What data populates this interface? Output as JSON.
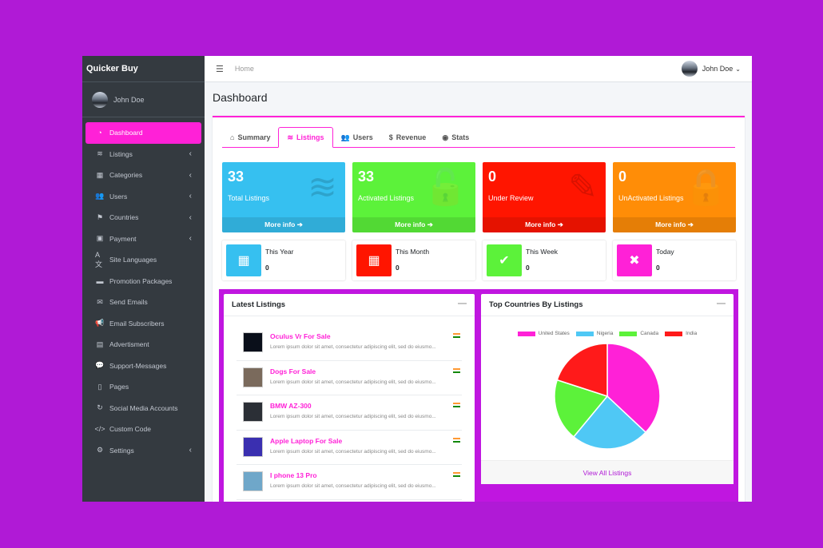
{
  "app": {
    "brand": "Quicker Buy",
    "user_name": "John Doe"
  },
  "sidebar": {
    "items": [
      {
        "label": "Dashboard",
        "icon": "tachometer-icon",
        "glyph": "◔",
        "has_chevron": false
      },
      {
        "label": "Listings",
        "icon": "layers-icon",
        "glyph": "≋",
        "has_chevron": true
      },
      {
        "label": "Categories",
        "icon": "grid-icon",
        "glyph": "▦",
        "has_chevron": true
      },
      {
        "label": "Users",
        "icon": "users-icon",
        "glyph": "👥",
        "has_chevron": true
      },
      {
        "label": "Countries",
        "icon": "flag-checkered-icon",
        "glyph": "⚑",
        "has_chevron": true
      },
      {
        "label": "Payment",
        "icon": "money-icon",
        "glyph": "▣",
        "has_chevron": true
      },
      {
        "label": "Site Languages",
        "icon": "language-icon",
        "glyph": "A文",
        "has_chevron": false
      },
      {
        "label": "Promotion Packages",
        "icon": "gift-icon",
        "glyph": "▬",
        "has_chevron": false
      },
      {
        "label": "Send Emails",
        "icon": "envelope-icon",
        "glyph": "✉",
        "has_chevron": false
      },
      {
        "label": "Email Subscribers",
        "icon": "bullhorn-icon",
        "glyph": "📢",
        "has_chevron": false
      },
      {
        "label": "Advertisment",
        "icon": "ad-icon",
        "glyph": "▤",
        "has_chevron": false
      },
      {
        "label": "Support-Messages",
        "icon": "comments-icon",
        "glyph": "💬",
        "has_chevron": false
      },
      {
        "label": "Pages",
        "icon": "file-icon",
        "glyph": "▯",
        "has_chevron": false
      },
      {
        "label": "Social Media Accounts",
        "icon": "sync-icon",
        "glyph": "↻",
        "has_chevron": false
      },
      {
        "label": "Custom Code",
        "icon": "code-icon",
        "glyph": "</>",
        "has_chevron": false
      },
      {
        "label": "Settings",
        "icon": "cogs-icon",
        "glyph": "⚙",
        "has_chevron": true
      }
    ],
    "active_index": 0
  },
  "topbar": {
    "breadcrumb": "Home",
    "user_name": "John Doe",
    "caret": "⌄"
  },
  "page": {
    "title": "Dashboard"
  },
  "tabs": [
    {
      "label": "Summary",
      "icon": "home-icon",
      "glyph": "⌂"
    },
    {
      "label": "Listings",
      "icon": "layers-icon",
      "glyph": "≋"
    },
    {
      "label": "Users",
      "icon": "users-icon",
      "glyph": "👥"
    },
    {
      "label": "Revenue",
      "icon": "dollar-icon",
      "glyph": "$"
    },
    {
      "label": "Stats",
      "icon": "eye-icon",
      "glyph": "◉"
    }
  ],
  "active_tab": 1,
  "stat_boxes": [
    {
      "value": "33",
      "label": "Total Listings",
      "more": "More info ➔",
      "color": "#36c0f0",
      "icon": "layers-icon",
      "glyph": "≋"
    },
    {
      "value": "33",
      "label": "Activated Listings",
      "more": "More info ➔",
      "color": "#5cf23a",
      "icon": "unlock-icon",
      "glyph": "🔓"
    },
    {
      "value": "0",
      "label": "Under Review",
      "more": "More info ➔",
      "color": "#ff1500",
      "icon": "pencil-icon",
      "glyph": "✎"
    },
    {
      "value": "0",
      "label": "UnActivated Listings",
      "more": "More info ➔",
      "color": "#ff8d07",
      "icon": "lock-icon",
      "glyph": "🔒"
    }
  ],
  "period_boxes": [
    {
      "label": "This Year",
      "value": "0",
      "color": "#36c0f0",
      "icon": "calendar-icon",
      "glyph": "▦"
    },
    {
      "label": "This Month",
      "value": "0",
      "color": "#ff1500",
      "icon": "calendar-grid-icon",
      "glyph": "▦"
    },
    {
      "label": "This Week",
      "value": "0",
      "color": "#5cf23a",
      "icon": "calendar-check-icon",
      "glyph": "✔"
    },
    {
      "label": "Today",
      "value": "0",
      "color": "#ff21d7",
      "icon": "calendar-times-icon",
      "glyph": "✖"
    }
  ],
  "latest_listings": {
    "title": "Latest Listings",
    "minimize": "—",
    "items": [
      {
        "title": "Oculus Vr For Sale",
        "desc": "Lorem ipsum dolor sit amet, consectetur adipiscing elit, sed do eiusmo...",
        "thumb_color": "#0a0f1a"
      },
      {
        "title": "Dogs For Sale",
        "desc": "Lorem ipsum dolor sit amet, consectetur adipiscing elit, sed do eiusmo...",
        "thumb_color": "#7a6a5c"
      },
      {
        "title": "BMW AZ-300",
        "desc": "Lorem ipsum dolor sit amet, consectetur adipiscing elit, sed do eiusmo...",
        "thumb_color": "#2b2f36"
      },
      {
        "title": "Apple Laptop For Sale",
        "desc": "Lorem ipsum dolor sit amet, consectetur adipiscing elit, sed do eiusmo...",
        "thumb_color": "#3a2fb0"
      },
      {
        "title": "I phone 13 Pro",
        "desc": "Lorem ipsum dolor sit amet, consectetur adipiscing elit, sed do eiusmo...",
        "thumb_color": "#6fa7c9"
      }
    ]
  },
  "top_countries": {
    "title": "Top Countries By Listings",
    "minimize": "—",
    "footer": "View All Listings"
  },
  "chart_data": {
    "type": "pie",
    "title": "",
    "legend_position": "top",
    "series": [
      {
        "name": "United States",
        "value": 37,
        "color": "#ff21d7"
      },
      {
        "name": "Nigeria",
        "value": 24,
        "color": "#4fc8f5"
      },
      {
        "name": "Canada",
        "value": 19,
        "color": "#5cf23a"
      },
      {
        "name": "India",
        "value": 20,
        "color": "#ff1a1a"
      }
    ]
  }
}
